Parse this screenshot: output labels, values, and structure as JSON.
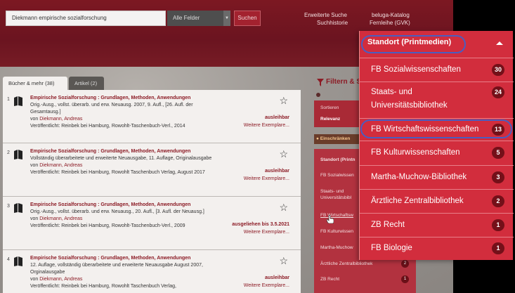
{
  "header": {
    "search_value": "Diekmann empirische sozialforschung",
    "field_select": "Alle Felder",
    "search_button": "Suchen",
    "links": {
      "advanced": "Erweiterte Suche",
      "history": "Suchhistorie",
      "catalog": "beluga-Katalog",
      "ill": "Fernleihe (GVK)"
    }
  },
  "tabs": {
    "books": "Bücher & mehr (38)",
    "articles": "Artikel (2)"
  },
  "results": [
    {
      "num": "1",
      "title": "Empirische Sozialforschung : Grundlagen, Methoden, Anwendungen",
      "edition": "Orig.-Ausg., vollst. überarb. und erw. Neuausg. 2007, 9. Aufl., [26. Aufl. der Gesamtausg.]",
      "author_prefix": "von",
      "author": "Diekmann, Andreas",
      "published": "Veröffentlicht: Reinbek bei Hamburg, Rowohlt-Taschenbuch-Verl., 2014",
      "status": "ausleihbar",
      "more": "Weitere Exemplare..."
    },
    {
      "num": "2",
      "title": "Empirische Sozialforschung : Grundlagen, Methoden, Anwendungen",
      "edition": "Vollständig überarbeitete und erweiterte Neuausgabe, 11. Auflage, Originalausgabe",
      "author_prefix": "von",
      "author": "Diekmann, Andreas",
      "published": "Veröffentlicht: Reinbek bei Hamburg, Rowohlt Taschenbuch Verlag, August 2017",
      "status": "ausleihbar",
      "more": "Weitere Exemplare..."
    },
    {
      "num": "3",
      "title": "Empirische Sozialforschung : Grundlagen, Methoden, Anwendungen",
      "edition": "Orig.-Ausg., vollst. überarb. und erw. Neuausg., 20. Aufl., [3. Aufl. der Neuausg.]",
      "author_prefix": "von",
      "author": "Diekmann, Andreas",
      "published": "Veröffentlicht: Reinbek bei Hamburg, Rowohlt-Taschenbuch-Verl., 2009",
      "status": "ausgeliehen bis 3.5.2021",
      "more": "Weitere Exemplare..."
    },
    {
      "num": "4",
      "title": "Empirische Sozialforschung : Grundlagen, Methoden, Anwendungen",
      "edition": "12. Auflage, vollständig überarbeitete und erweiterte Neuausgabe August 2007, Orginalausgabe",
      "author_prefix": "von",
      "author": "Diekmann, Andreas",
      "published": "Veröffentlicht: Reinbek bei Hamburg, Rowohlt Taschenbuch Verlag,",
      "status": "ausleihbar",
      "more": "Weitere Exemplare..."
    }
  ],
  "filter": {
    "title": "Filtern & S",
    "sort_label": "Sortieren",
    "sort_value": "Relevanz",
    "restrict": "Einschränken",
    "facets_behind": [
      {
        "label": "Standort (Printn",
        "count": ""
      },
      {
        "label": "FB Sozialwissen",
        "count": ""
      },
      {
        "label": "Staats- und Universitätsbibl",
        "count": ""
      },
      {
        "label": "FB Wirtschaftsw",
        "count": ""
      },
      {
        "label": "FB Kulturwissen",
        "count": ""
      },
      {
        "label": "Martha-Muchow",
        "count": ""
      },
      {
        "label": "Ärztliche Zentralbibliothek",
        "count": "2"
      },
      {
        "label": "ZB Recht",
        "count": "1"
      }
    ]
  },
  "dropdown": {
    "header": "Standort (Printmedien)",
    "items": [
      {
        "label": "FB Sozialwissenschaften",
        "count": "30"
      },
      {
        "label": "Staats- und Universitätsbibliothek",
        "count": "24"
      },
      {
        "label": "FB Wirtschaftswissenschaften",
        "count": "13"
      },
      {
        "label": "FB Kulturwissenschaften",
        "count": "5"
      },
      {
        "label": "Martha-Muchow-Bibliothek",
        "count": "3"
      },
      {
        "label": "Ärztliche Zentralbibliothek",
        "count": "2"
      },
      {
        "label": "ZB Recht",
        "count": "1"
      },
      {
        "label": "FB Biologie",
        "count": "1"
      }
    ]
  },
  "colors": {
    "brand": "#7c1822",
    "accent": "#d22d3d",
    "badge": "#741019",
    "highlight_ring": "#4a5dc0"
  }
}
